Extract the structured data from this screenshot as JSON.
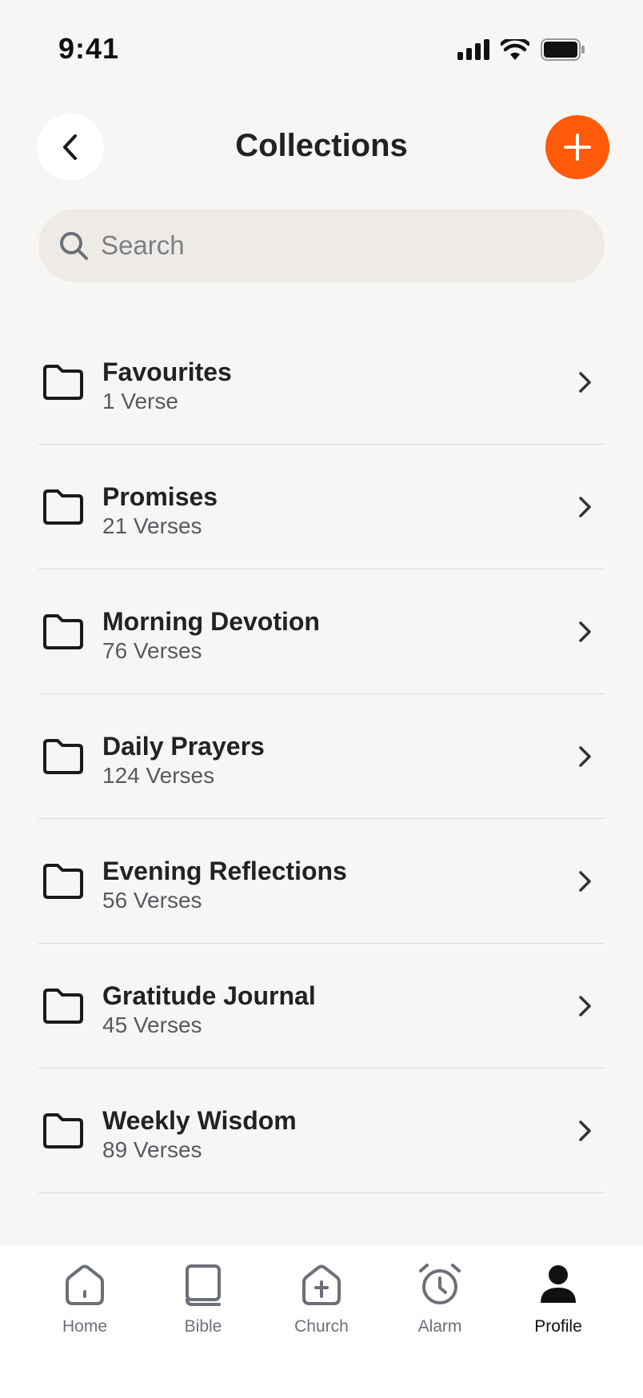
{
  "status_bar": {
    "time": "9:41"
  },
  "header": {
    "title": "Collections"
  },
  "search": {
    "placeholder": "Search",
    "value": ""
  },
  "collections": [
    {
      "name": "Favourites",
      "count": "1 Verse"
    },
    {
      "name": "Promises",
      "count": "21 Verses"
    },
    {
      "name": "Morning Devotion",
      "count": "76 Verses"
    },
    {
      "name": "Daily Prayers",
      "count": "124 Verses"
    },
    {
      "name": "Evening Reflections",
      "count": "56 Verses"
    },
    {
      "name": "Gratitude Journal",
      "count": "45 Verses"
    },
    {
      "name": "Weekly Wisdom",
      "count": "89 Verses"
    }
  ],
  "tabbar": {
    "tabs": [
      {
        "label": "Home",
        "icon": "home-icon"
      },
      {
        "label": "Bible",
        "icon": "book-icon"
      },
      {
        "label": "Church",
        "icon": "church-icon"
      },
      {
        "label": "Alarm",
        "icon": "alarm-icon"
      },
      {
        "label": "Profile",
        "icon": "profile-icon",
        "active": true
      }
    ]
  },
  "colors": {
    "accent": "#ff5a0a",
    "background": "#f7f6f4",
    "search_bg": "#eeebe7"
  }
}
